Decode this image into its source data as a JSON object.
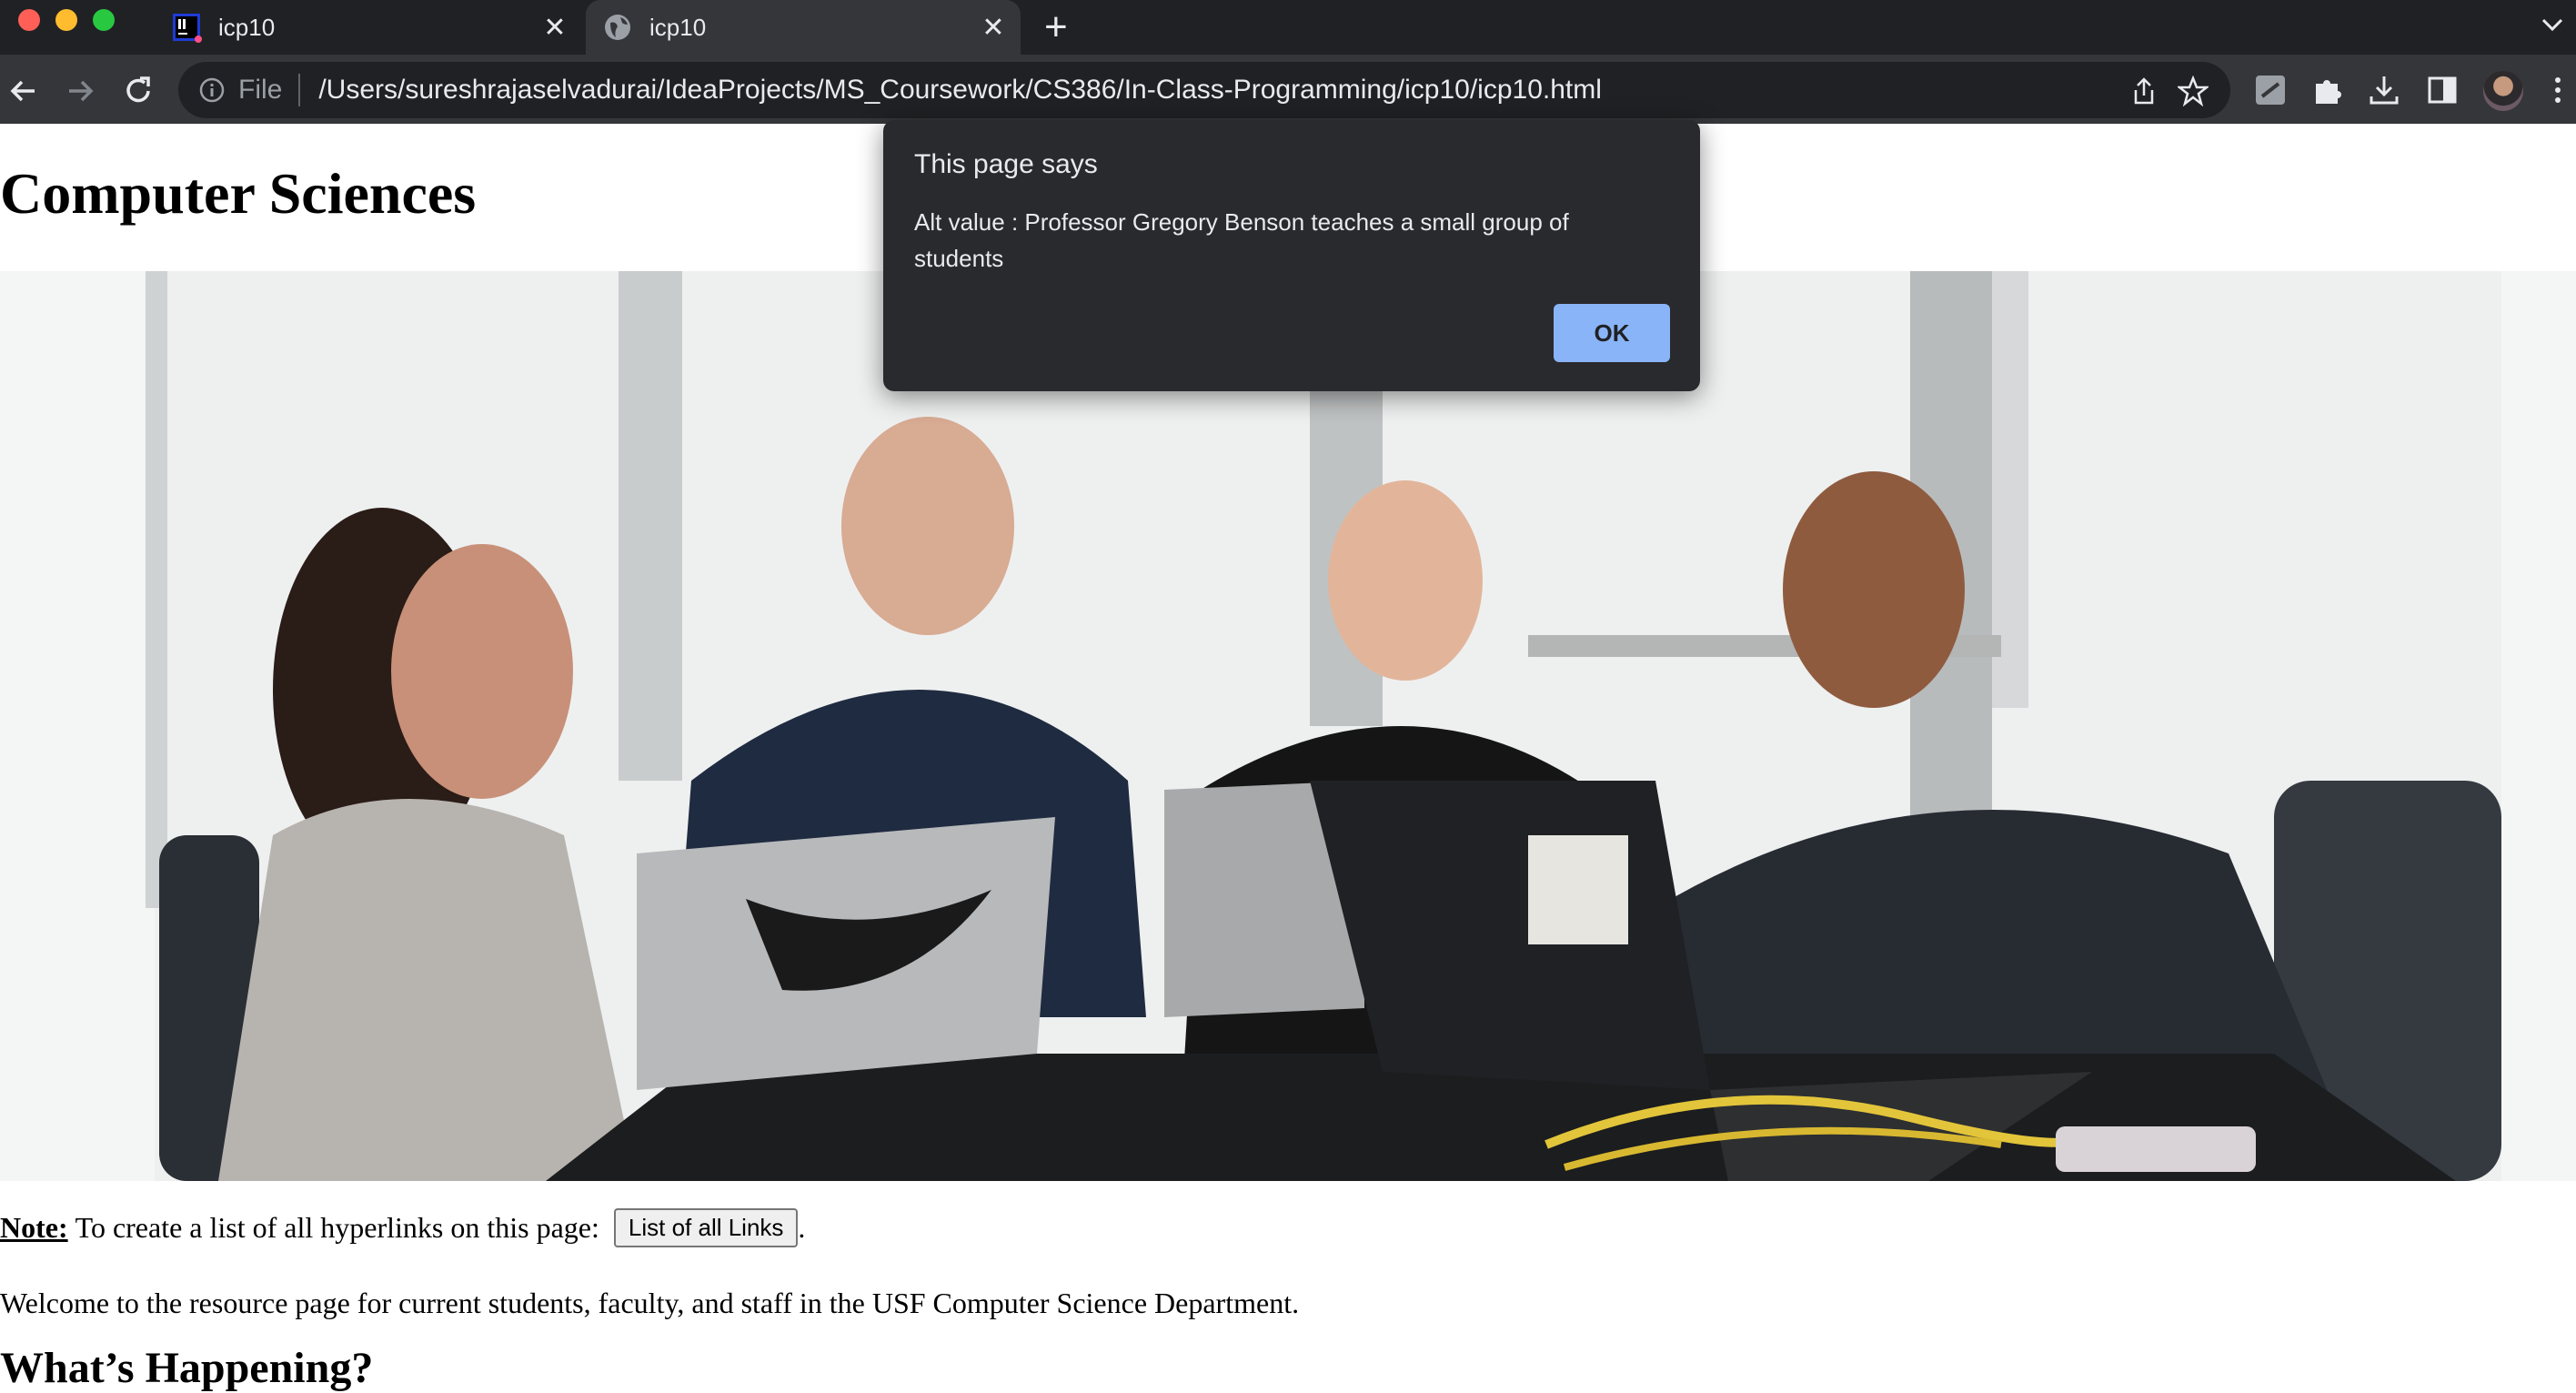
{
  "browser": {
    "tabs": [
      {
        "title": "icp10",
        "icon": "intellij-icon"
      },
      {
        "title": "icp10",
        "icon": "globe-icon",
        "active": true
      }
    ],
    "address": {
      "scheme_label": "File",
      "url": "/Users/sureshrajaselvadurai/IdeaProjects/MS_Coursework/CS386/In-Class-Programming/icp10/icp10.html"
    }
  },
  "page": {
    "heading": "Computer Sciences",
    "image_alt": "Professor Gregory Benson teaches a small group of students",
    "note_label": "Note:",
    "note_text": "To create a list of all hyperlinks on this page:",
    "links_button": "List of all Links",
    "note_end": ".",
    "welcome": "Welcome to the resource page for current students, faculty, and staff in the USF Computer Science Department.",
    "section_heading": "What’s Happening?"
  },
  "dialog": {
    "title": "This page says",
    "message": "Alt value : Professor Gregory Benson teaches a small group of students",
    "ok_label": "OK"
  },
  "colors": {
    "tabbar": "#202124",
    "toolbar": "#35363a",
    "dialog_bg": "#292a2d",
    "dialog_button": "#8ab4f8"
  }
}
